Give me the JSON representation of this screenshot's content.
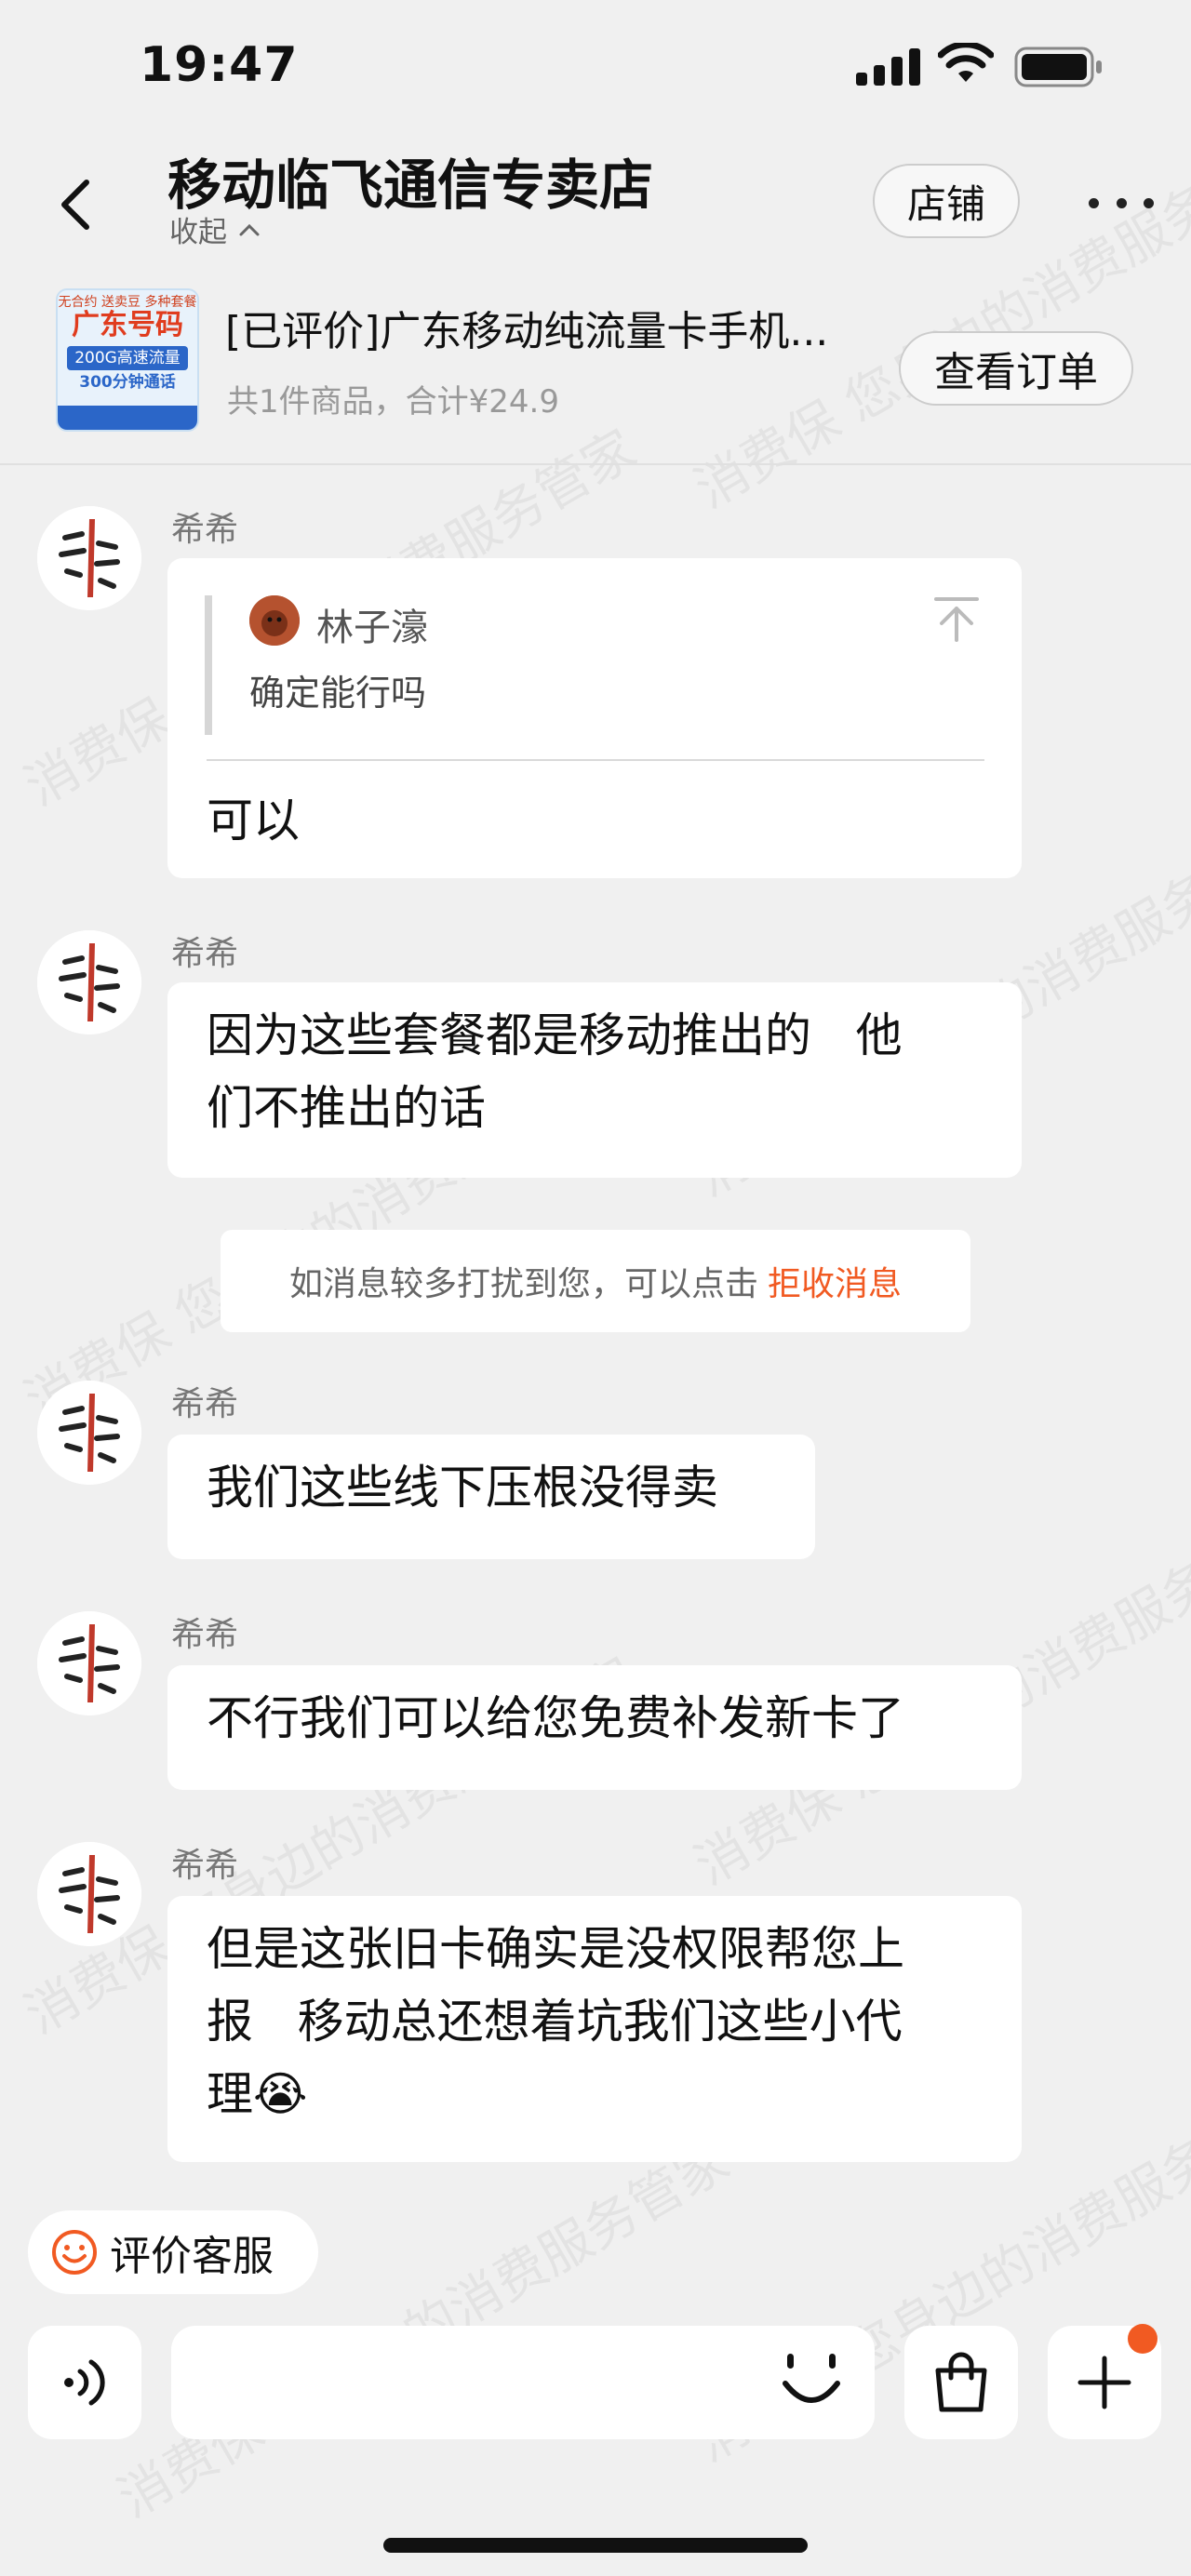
{
  "status_bar": {
    "time": "19:47"
  },
  "header": {
    "shop_name": "移动临飞通信专卖店",
    "collapse_label": "收起",
    "store_button": "店铺"
  },
  "order": {
    "thumb": {
      "top_text": "无合约 送卖豆 多种套餐",
      "title": "广东号码",
      "flow": "200G高速流量",
      "call": "300分钟通话"
    },
    "title": "[已评价]广东移动纯流量卡手机...",
    "summary": "共1件商品，合计¥24.9",
    "view_order_button": "查看订单"
  },
  "messages": [
    {
      "sender": "希希",
      "quote": {
        "name": "林子濠",
        "text": "确定能行吗"
      },
      "lines": [
        "可以"
      ]
    },
    {
      "sender": "希希",
      "lines": [
        "因为这些套餐都是移动推出的   他",
        "们不推出的话"
      ]
    },
    {
      "sender": "希希",
      "lines": [
        "我们这些线下压根没得卖"
      ]
    },
    {
      "sender": "希希",
      "lines": [
        "不行我们可以给您免费补发新卡了"
      ]
    },
    {
      "sender": "希希",
      "lines": [
        "但是这张旧卡确实是没权限帮您上",
        "报   移动总还想着坑我们这些小代",
        "理😭"
      ]
    }
  ],
  "system_notice": {
    "text": "如消息较多打扰到您，可以点击",
    "action": "拒收消息"
  },
  "rate_button": "评价客服",
  "watermark_text": "消费保 您身边的消费服务管家",
  "colors": {
    "accent": "#f15a22",
    "background": "#f0f0f0",
    "bubble": "#ffffff"
  },
  "icons": [
    "back-icon",
    "chevron-up-icon",
    "more-icon",
    "pin-top-icon",
    "smile-icon",
    "voice-icon",
    "emoji-icon",
    "shopping-bag-icon",
    "plus-icon"
  ]
}
